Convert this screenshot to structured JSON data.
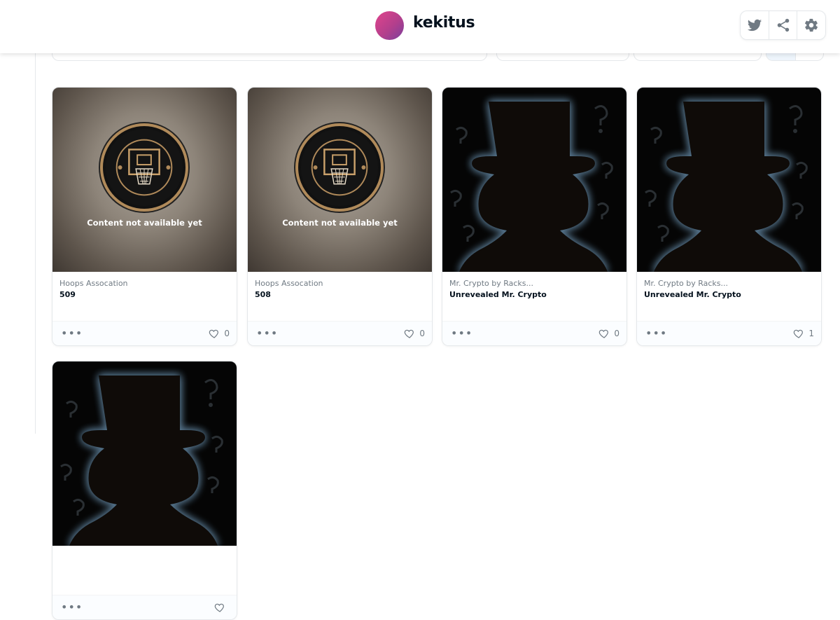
{
  "header": {
    "username": "kekitus",
    "actions": [
      {
        "icon": "twitter-icon"
      },
      {
        "icon": "share-icon"
      },
      {
        "icon": "gear-icon"
      }
    ]
  },
  "colors": {
    "avatar_start": "#e0448c",
    "avatar_end": "#7b3f9c",
    "text_primary": "#04111d",
    "text_secondary": "#707a83"
  },
  "items": [
    {
      "collection": "Hoops Assocation",
      "name": "509",
      "likes": "0",
      "overlay_text": "Content not available yet",
      "media": "hoops-association-badge"
    },
    {
      "collection": "Hoops Assocation",
      "name": "508",
      "likes": "0",
      "overlay_text": "Content not available yet",
      "media": "hoops-association-badge"
    },
    {
      "collection": "Mr. Crypto by Racks...",
      "name": "Unrevealed Mr. Crypto",
      "likes": "0",
      "media": "mr-crypto-silhouette"
    },
    {
      "collection": "Mr. Crypto by Racks...",
      "name": "Unrevealed Mr. Crypto",
      "likes": "1",
      "media": "mr-crypto-silhouette"
    },
    {
      "media": "mr-crypto-silhouette"
    }
  ],
  "more_icon": "more-dots-icon",
  "like_icon": "heart-icon"
}
